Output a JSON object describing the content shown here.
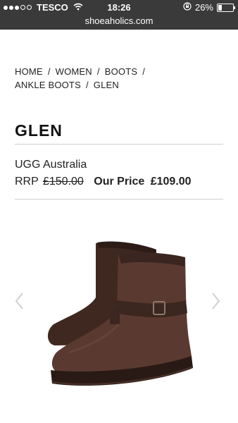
{
  "status_bar": {
    "carrier": "TESCO",
    "time": "18:26",
    "battery": "26%",
    "battery_level": 0.26,
    "url": "shoeaholics.com"
  },
  "breadcrumb": [
    "HOME",
    "WOMEN",
    "BOOTS",
    "ANKLE BOOTS",
    "GLEN"
  ],
  "product": {
    "name": "GLEN",
    "brand": "UGG Australia",
    "rrp_label": "RRP",
    "rrp_value": "£150.00",
    "our_price_label": "Our Price",
    "our_price_value": "£109.00"
  },
  "icons": {
    "prev": "chevron-left-icon",
    "next": "chevron-right-icon"
  },
  "colors": {
    "status_bar": "#3a3a3a",
    "boot": "#4b3128",
    "arrow": "#cfcfcf"
  }
}
